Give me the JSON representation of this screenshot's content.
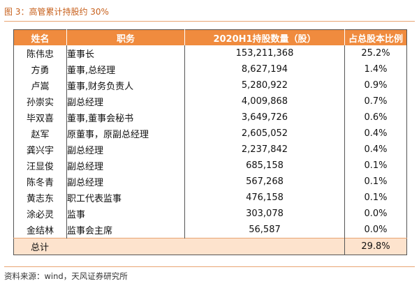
{
  "caption": "图 3：高管累计持股约 30%",
  "source": "资料来源：wind，天风证券研究所",
  "table": {
    "headers": [
      "姓名",
      "职务",
      "2020H1持股数量（股）",
      "占总股本比例"
    ],
    "rows": [
      {
        "name": "陈伟忠",
        "title": "董事长",
        "shares": "153,211,368",
        "pct": "25.2%"
      },
      {
        "name": "方勇",
        "title": "董事,总经理",
        "shares": "8,627,194",
        "pct": "1.4%"
      },
      {
        "name": "卢嵩",
        "title": "董事,财务负责人",
        "shares": "5,280,922",
        "pct": "0.9%"
      },
      {
        "name": "孙崇实",
        "title": "副总经理",
        "shares": "4,009,868",
        "pct": "0.7%"
      },
      {
        "name": "毕双喜",
        "title": "董事,董事会秘书",
        "shares": "3,649,726",
        "pct": "0.6%"
      },
      {
        "name": "赵军",
        "title": "原董事，原副总经理",
        "shares": "2,605,052",
        "pct": "0.4%"
      },
      {
        "name": "龚兴宇",
        "title": "副总经理",
        "shares": "2,237,842",
        "pct": "0.4%"
      },
      {
        "name": "汪显俊",
        "title": "副总经理",
        "shares": "685,158",
        "pct": "0.1%"
      },
      {
        "name": "陈冬青",
        "title": "副总经理",
        "shares": "567,268",
        "pct": "0.1%"
      },
      {
        "name": "黄志东",
        "title": "职工代表监事",
        "shares": "476,158",
        "pct": "0.1%"
      },
      {
        "name": "涂必灵",
        "title": "监事",
        "shares": "303,078",
        "pct": "0.0%"
      },
      {
        "name": "金结林",
        "title": "监事会主席",
        "shares": "56,587",
        "pct": "0.0%"
      }
    ],
    "total": {
      "label": "总计",
      "pct": "29.8%"
    }
  }
}
